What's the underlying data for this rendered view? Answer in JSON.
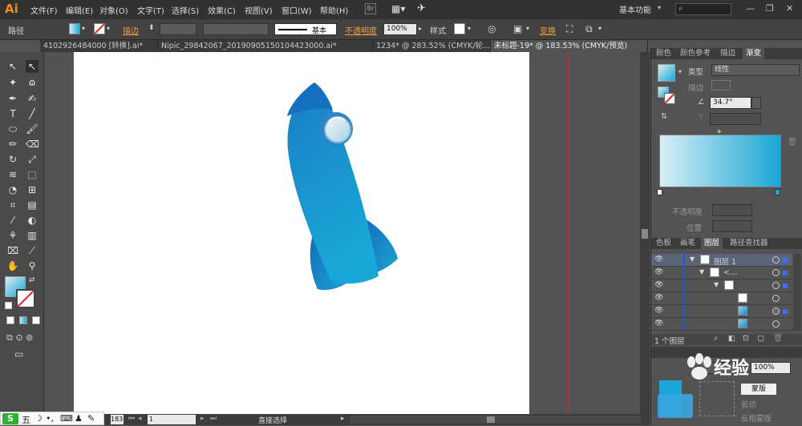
{
  "menubar": {
    "logo": "Ai",
    "items": [
      "文件(F)",
      "编辑(E)",
      "对象(O)",
      "文字(T)",
      "选择(S)",
      "效果(C)",
      "视图(V)",
      "窗口(W)",
      "帮助(H)"
    ],
    "workspace": "基本功能",
    "window_buttons": [
      "—",
      "❐",
      "✕"
    ]
  },
  "controlbar": {
    "path_label": "路径",
    "stroke_label": "描边",
    "stroke_style": "基本",
    "opacity_label": "不透明度",
    "opacity_value": "100%",
    "style_label": "样式",
    "transform_label": "变换"
  },
  "tabs": [
    "410292648400​0 [转换].ai*",
    "Nipic_29842067_20190905150104423000.ai*",
    "1234* @ 283.52% (CMYK/轮…",
    "未标题-19* @ 183.53% (CMYK/预览)"
  ],
  "gradient_panel": {
    "tabs": [
      "颜色",
      "颜色参考",
      "描边",
      "渐变"
    ],
    "type_label": "类型",
    "type_value": "线性",
    "stroke_label": "描边",
    "angle_value": "34.7°",
    "opacity_label": "不透明度",
    "position_label": "位置",
    "start_color": "#d6eef5",
    "end_color": "#1aa7d5"
  },
  "layers_panel": {
    "tabs": [
      "色板",
      "画笔",
      "图层",
      "路径查找器"
    ],
    "rows": [
      {
        "name": "图层 1"
      },
      {
        "name": "<…"
      },
      {
        "name": ""
      },
      {
        "name": ""
      },
      {
        "name": ""
      },
      {
        "name": ""
      }
    ],
    "footer": "1 个图层"
  },
  "transparency_panel": {
    "opacity_value": "100%",
    "mask_label": "蒙版",
    "clip_label": "剪切",
    "invert_label": "反相蒙版"
  },
  "statusbar": {
    "zoom": "183",
    "page": "1",
    "tool": "直接选择"
  },
  "ime": {
    "logo": "S",
    "mode": "五"
  },
  "watermark": "经验"
}
